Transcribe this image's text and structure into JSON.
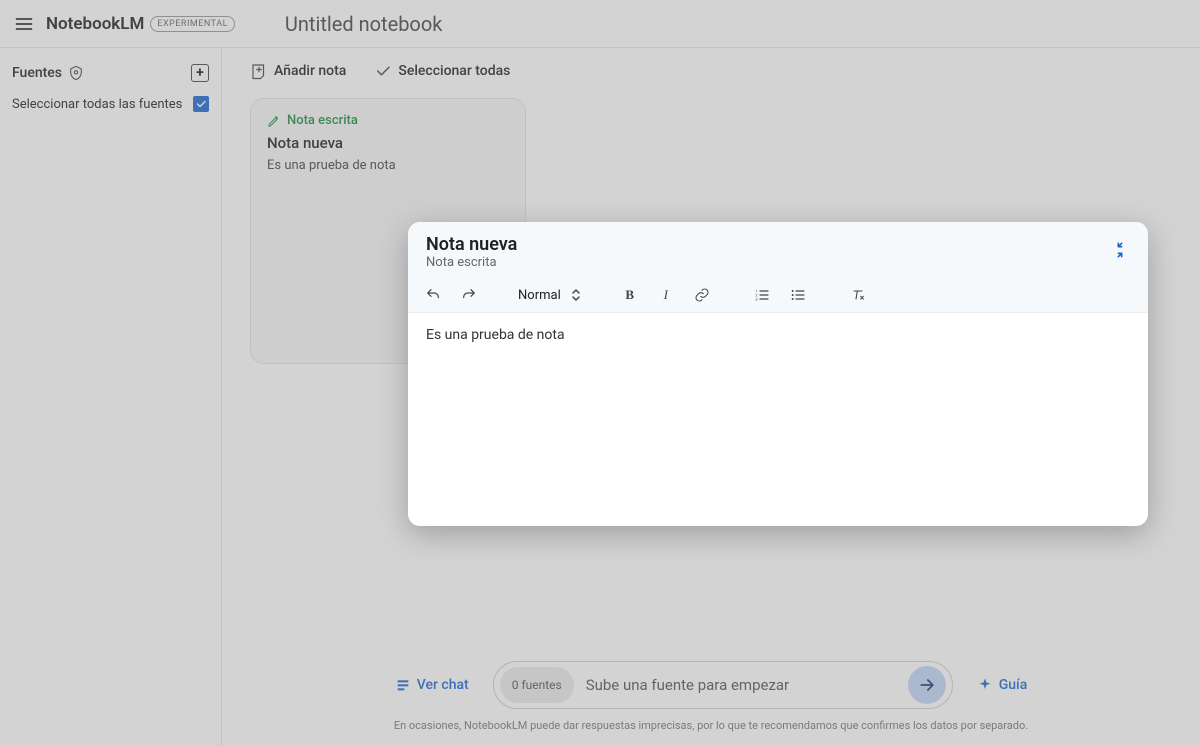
{
  "header": {
    "brand": "NotebookLM",
    "badge": "EXPERIMENTAL",
    "notebook_title": "Untitled notebook"
  },
  "sidebar": {
    "sources_label": "Fuentes",
    "select_all_label": "Seleccionar todas las fuentes"
  },
  "toolbar": {
    "add_note": "Añadir nota",
    "select_all": "Seleccionar todas"
  },
  "note_card": {
    "tag": "Nota escrita",
    "title": "Nota nueva",
    "body": "Es una prueba de nota"
  },
  "editor": {
    "title": "Nota nueva",
    "subtitle": "Nota escrita",
    "format": "Normal",
    "content": "Es una prueba de nota"
  },
  "bottom": {
    "ver_chat": "Ver chat",
    "source_count": "0 fuentes",
    "placeholder": "Sube una fuente para empezar",
    "guia": "Guía",
    "disclaimer": "En ocasiones, NotebookLM puede dar respuestas imprecisas, por lo que te recomendamos que confirmes los datos por separado."
  }
}
